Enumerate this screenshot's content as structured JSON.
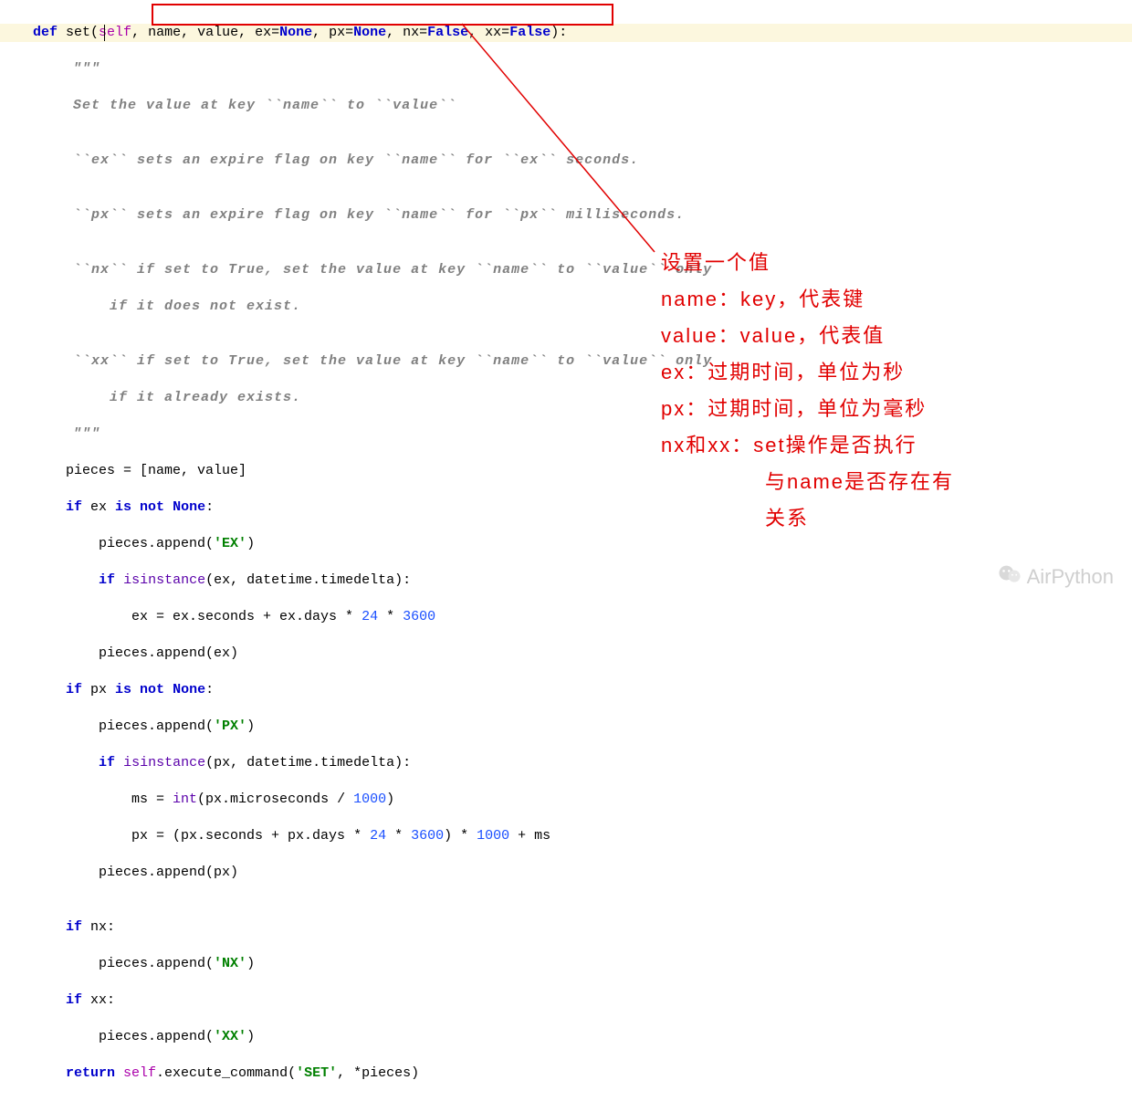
{
  "code": {
    "l01a": "    def ",
    "l01b": "set",
    "l01c": "(",
    "l01d": "self",
    "l01e": ", name, value, ex=",
    "l01f": "None",
    "l01g": ", px=",
    "l01h": "None",
    "l01i": ", nx=",
    "l01j": "False",
    "l01k": ", xx=",
    "l01l": "False",
    "l01m": "):",
    "l02": "        \"\"\"",
    "l03": "        Set the value at key ``name`` to ``value``",
    "l04": "",
    "l05": "        ``ex`` sets an expire flag on key ``name`` for ``ex`` seconds.",
    "l06": "",
    "l07": "        ``px`` sets an expire flag on key ``name`` for ``px`` milliseconds.",
    "l08": "",
    "l09": "        ``nx`` if set to True, set the value at key ``name`` to ``value`` only",
    "l10": "            if it does not exist.",
    "l11": "",
    "l12": "        ``xx`` if set to True, set the value at key ``name`` to ``value`` only",
    "l13": "            if it already exists.",
    "l14": "        \"\"\"",
    "l15a": "        pieces = [name, value]",
    "l16a": "        ",
    "l16b": "if",
    "l16c": " ex ",
    "l16d": "is not ",
    "l16e": "None",
    "l16f": ":",
    "l17a": "            pieces.append(",
    "l17b": "'EX'",
    "l17c": ")",
    "l18a": "            ",
    "l18b": "if",
    "l18c": " ",
    "l18d": "isinstance",
    "l18e": "(ex, datetime.timedelta):",
    "l19a": "                ex = ex.seconds + ex.days * ",
    "l19b": "24",
    "l19c": " * ",
    "l19d": "3600",
    "l20a": "            pieces.append(ex)",
    "l21a": "        ",
    "l21b": "if",
    "l21c": " px ",
    "l21d": "is not ",
    "l21e": "None",
    "l21f": ":",
    "l22a": "            pieces.append(",
    "l22b": "'PX'",
    "l22c": ")",
    "l23a": "            ",
    "l23b": "if",
    "l23c": " ",
    "l23d": "isinstance",
    "l23e": "(px, datetime.timedelta):",
    "l24a": "                ms = ",
    "l24b": "int",
    "l24c": "(px.microseconds / ",
    "l24d": "1000",
    "l24e": ")",
    "l25a": "                px = (px.seconds + px.days * ",
    "l25b": "24",
    "l25c": " * ",
    "l25d": "3600",
    "l25e": ") * ",
    "l25f": "1000",
    "l25g": " + ms",
    "l26a": "            pieces.append(px)",
    "l27": "",
    "l28a": "        ",
    "l28b": "if",
    "l28c": " nx:",
    "l29a": "            pieces.append(",
    "l29b": "'NX'",
    "l29c": ")",
    "l30a": "        ",
    "l30b": "if",
    "l30c": " xx:",
    "l31a": "            pieces.append(",
    "l31b": "'XX'",
    "l31c": ")",
    "l32a": "        ",
    "l32b": "return ",
    "l32c": "self",
    "l32d": ".execute_command(",
    "l32e": "'SET'",
    "l32f": ", *pieces)"
  },
  "anno": {
    "a1": "设置一个值",
    "a2": "name：key，代表键",
    "a3": "value：value，代表值",
    "a4": "ex：过期时间，单位为秒",
    "a5": "px：过期时间，单位为毫秒",
    "a6": "nx和xx：set操作是否执行",
    "a7": "与name是否存在有",
    "a8": "关系"
  },
  "watermark": "AirPython"
}
